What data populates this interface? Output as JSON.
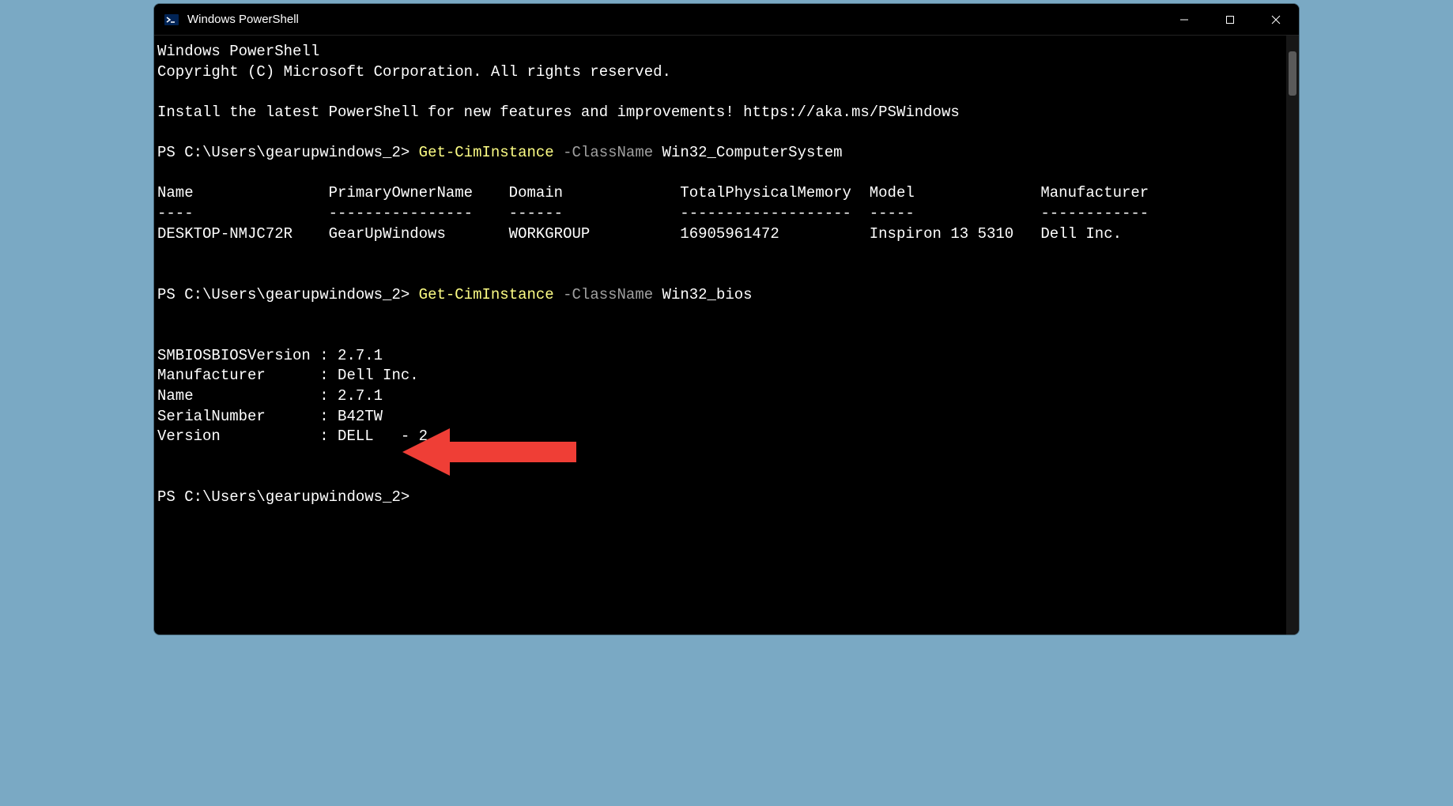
{
  "window": {
    "title": "Windows PowerShell"
  },
  "terminal": {
    "header1": "Windows PowerShell",
    "header2": "Copyright (C) Microsoft Corporation. All rights reserved.",
    "install_msg": "Install the latest PowerShell for new features and improvements! https://aka.ms/PSWindows",
    "prompt_path": "PS C:\\Users\\gearupwindows_2>",
    "cmd1": {
      "cmdlet": "Get-CimInstance",
      "param": "-ClassName",
      "value": "Win32_ComputerSystem"
    },
    "table1": {
      "header_line": "Name               PrimaryOwnerName    Domain             TotalPhysicalMemory  Model              Manufacturer",
      "divider_line": "----               ----------------    ------             -------------------  -----              ------------",
      "row_line": "DESKTOP-NMJC72R    GearUpWindows       WORKGROUP          16905961472          Inspiron 13 5310   Dell Inc."
    },
    "cmd2": {
      "cmdlet": "Get-CimInstance",
      "param": "-ClassName",
      "value": "Win32_bios"
    },
    "list2": {
      "l1": "SMBIOSBIOSVersion : 2.7.1",
      "l2": "Manufacturer      : Dell Inc.",
      "l3": "Name              : 2.7.1",
      "l4": "SerialNumber      : B42TW",
      "l5": "Version           : DELL   - 2"
    }
  }
}
